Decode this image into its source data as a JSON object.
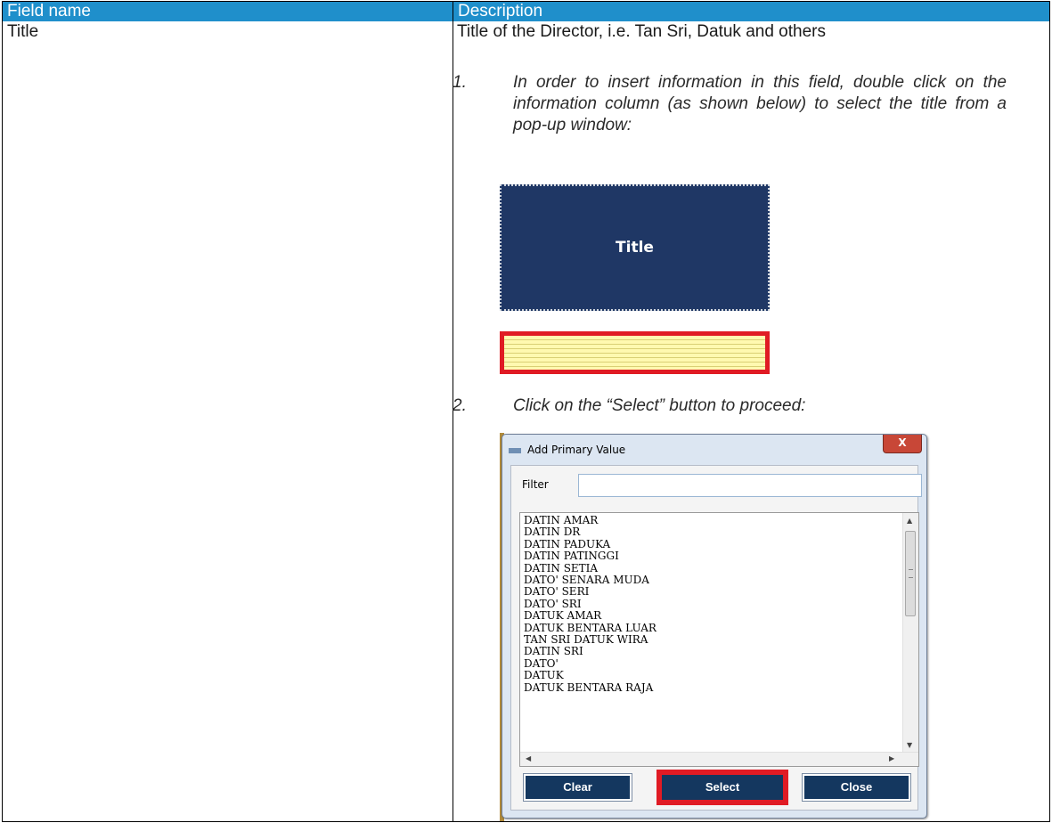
{
  "table": {
    "headers": [
      "Field name",
      "Description"
    ],
    "field_name": "Title",
    "description": "Title of the Director, i.e. Tan Sri, Datuk and others"
  },
  "steps": [
    {
      "number": "1.",
      "text": "In order to insert information in this field, double click on the information column (as shown below) to select the title from a pop-up window:"
    },
    {
      "number": "2.",
      "text": "Click on the “Select” button to proceed:"
    }
  ],
  "title_column": {
    "label": "Title"
  },
  "dialog": {
    "title": "Add Primary Value",
    "close_glyph": "X",
    "filter_label": "Filter",
    "filter_value": "",
    "items": [
      "DATIN AMAR",
      "DATIN DR",
      "DATIN PADUKA",
      "DATIN PATINGGI",
      "DATIN SETIA",
      "DATO' SENARA MUDA",
      "DATO' SERI",
      "DATO' SRI",
      "DATUK AMAR",
      "DATUK BENTARA LUAR",
      "TAN SRI DATUK WIRA",
      "DATIN SRI",
      "DATO'",
      "DATUK",
      "DATUK BENTARA RAJA"
    ],
    "buttons": {
      "clear": "Clear",
      "select": "Select",
      "close": "Close"
    }
  },
  "colors": {
    "header_bg": "#1f8fcb",
    "title_box": "#1f3765",
    "highlight": "#e01b24",
    "button": "#14375f"
  }
}
